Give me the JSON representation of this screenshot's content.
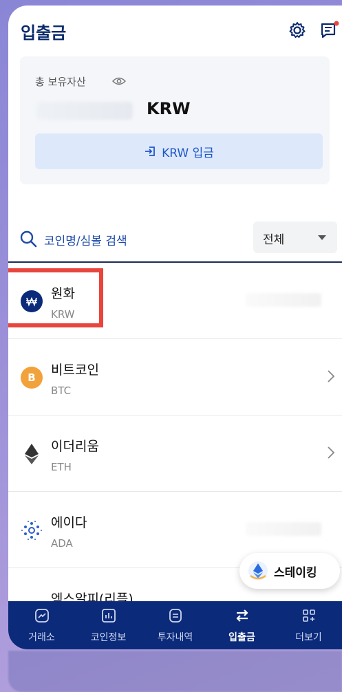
{
  "header": {
    "title": "입출금",
    "icons": [
      "gear-icon",
      "notice-icon"
    ],
    "accent": "#0b2a6b"
  },
  "asset": {
    "label": "총 보유자산",
    "currency": "KRW",
    "deposit_label": "KRW 입금"
  },
  "search": {
    "placeholder": "코인명/심볼 검색",
    "filter_value": "전체"
  },
  "coins": [
    {
      "name": "원화",
      "symbol": "KRW",
      "icon": "won-icon",
      "color": "#0b2a7a"
    },
    {
      "name": "비트코인",
      "symbol": "BTC",
      "icon": "bitcoin-icon",
      "color": "#f2a23a"
    },
    {
      "name": "이더리움",
      "symbol": "ETH",
      "icon": "ethereum-icon",
      "color": "#333333"
    },
    {
      "name": "에이다",
      "symbol": "ADA",
      "icon": "cardano-icon",
      "color": "#2b5fc7"
    },
    {
      "name": "엑스알피(리플)",
      "symbol": "",
      "icon": "xrp-icon",
      "color": "#333333"
    }
  ],
  "staking": {
    "label": "스테이킹"
  },
  "tabs": [
    {
      "label": "거래소",
      "icon": "exchange-icon"
    },
    {
      "label": "코인정보",
      "icon": "chart-icon"
    },
    {
      "label": "투자내역",
      "icon": "document-icon"
    },
    {
      "label": "입출금",
      "icon": "transfer-icon",
      "active": true
    },
    {
      "label": "더보기",
      "icon": "more-grid-icon"
    }
  ],
  "colors": {
    "highlight": "#e8453c",
    "tabbar": "#0b2a7a",
    "link": "#1f56c9"
  }
}
